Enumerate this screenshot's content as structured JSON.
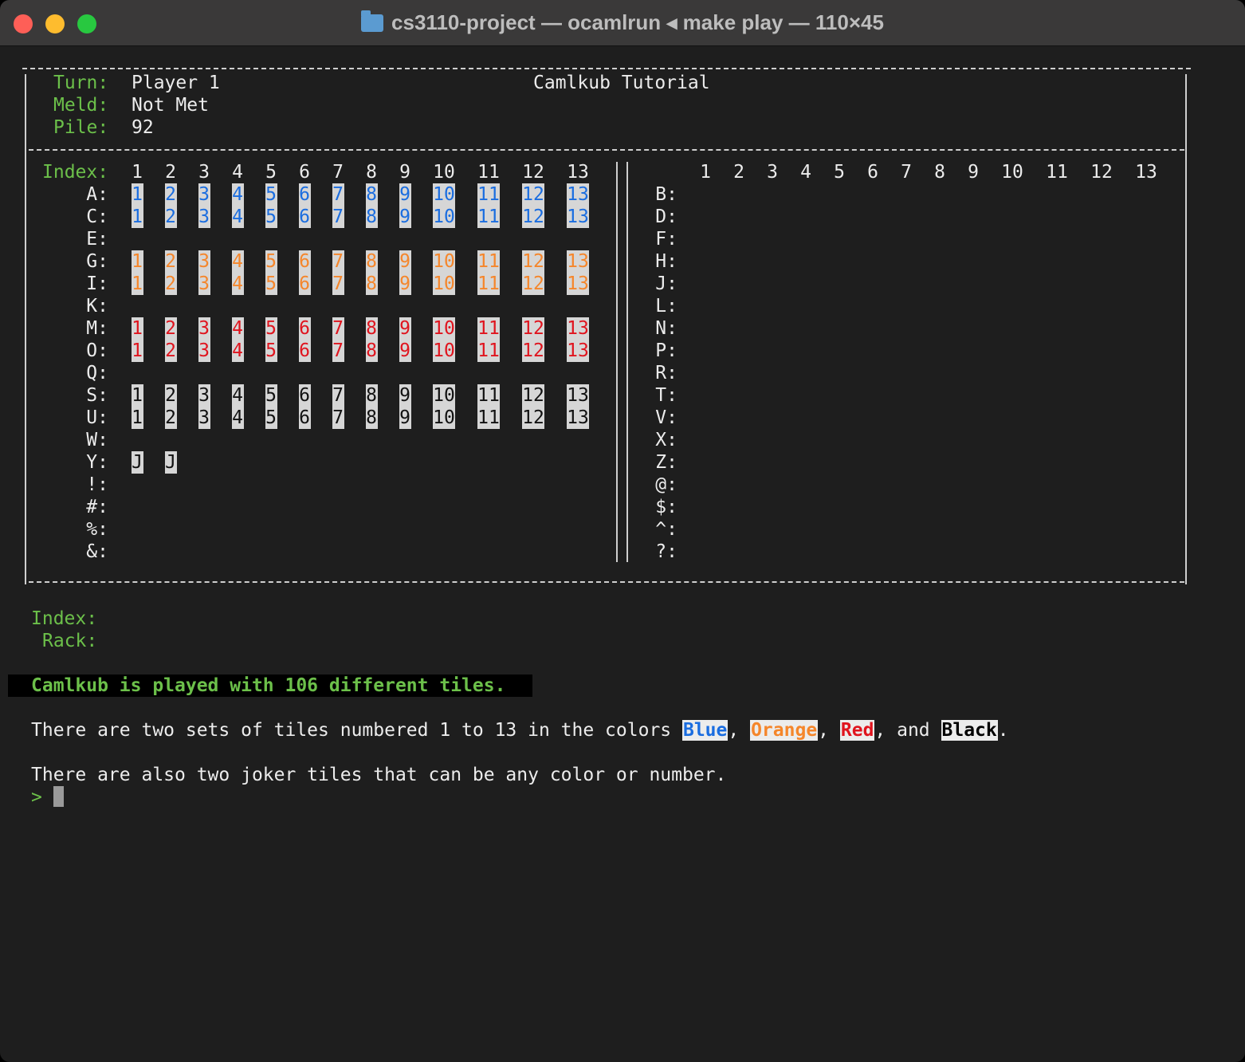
{
  "window": {
    "title": "cs3110-project — ocamlrun ◂ make play — 110×45",
    "folder_icon": "folder-icon"
  },
  "header": {
    "turn_label": "Turn:",
    "turn_value": "Player 1",
    "meld_label": "Meld:",
    "meld_value": "Not Met",
    "pile_label": "Pile:",
    "pile_value": "92",
    "title": "Camlkub Tutorial"
  },
  "board": {
    "index_label": "Index:",
    "columns": [
      "1",
      "2",
      "3",
      "4",
      "5",
      "6",
      "7",
      "8",
      "9",
      "10",
      "11",
      "12",
      "13"
    ],
    "left_rows": [
      "A:",
      "C:",
      "E:",
      "G:",
      "I:",
      "K:",
      "M:",
      "O:",
      "Q:",
      "S:",
      "U:",
      "W:",
      "Y:",
      "!:",
      "#:",
      "%:",
      "&:"
    ],
    "right_rows": [
      "B:",
      "D:",
      "F:",
      "H:",
      "J:",
      "L:",
      "N:",
      "P:",
      "R:",
      "T:",
      "V:",
      "X:",
      "Z:",
      "@:",
      "$:",
      "^:",
      "?:"
    ],
    "left_tiles": [
      {
        "row": 0,
        "color": "#1a6de0",
        "values": [
          "1",
          "2",
          "3",
          "4",
          "5",
          "6",
          "7",
          "8",
          "9",
          "10",
          "11",
          "12",
          "13"
        ]
      },
      {
        "row": 1,
        "color": "#1a6de0",
        "values": [
          "1",
          "2",
          "3",
          "4",
          "5",
          "6",
          "7",
          "8",
          "9",
          "10",
          "11",
          "12",
          "13"
        ]
      },
      {
        "row": 3,
        "color": "#f5862b",
        "values": [
          "1",
          "2",
          "3",
          "4",
          "5",
          "6",
          "7",
          "8",
          "9",
          "10",
          "11",
          "12",
          "13"
        ]
      },
      {
        "row": 4,
        "color": "#f5862b",
        "values": [
          "1",
          "2",
          "3",
          "4",
          "5",
          "6",
          "7",
          "8",
          "9",
          "10",
          "11",
          "12",
          "13"
        ]
      },
      {
        "row": 6,
        "color": "#e0141e",
        "values": [
          "1",
          "2",
          "3",
          "4",
          "5",
          "6",
          "7",
          "8",
          "9",
          "10",
          "11",
          "12",
          "13"
        ]
      },
      {
        "row": 7,
        "color": "#e0141e",
        "values": [
          "1",
          "2",
          "3",
          "4",
          "5",
          "6",
          "7",
          "8",
          "9",
          "10",
          "11",
          "12",
          "13"
        ]
      },
      {
        "row": 9,
        "color": "#111111",
        "values": [
          "1",
          "2",
          "3",
          "4",
          "5",
          "6",
          "7",
          "8",
          "9",
          "10",
          "11",
          "12",
          "13"
        ]
      },
      {
        "row": 10,
        "color": "#111111",
        "values": [
          "1",
          "2",
          "3",
          "4",
          "5",
          "6",
          "7",
          "8",
          "9",
          "10",
          "11",
          "12",
          "13"
        ]
      },
      {
        "row": 12,
        "color": "#111111",
        "values": [
          "J",
          "J"
        ]
      }
    ]
  },
  "rack": {
    "index_label": "Index:",
    "rack_label": "Rack:"
  },
  "tutorial": {
    "headline": "Camlkub is played with 106 different tiles.",
    "line1_before": "There are two sets of tiles numbered 1 to 13 in the colors ",
    "color_blue": "Blue",
    "sep1": ", ",
    "color_orange": "Orange",
    "sep2": ", ",
    "color_red": "Red",
    "sep3": ", and ",
    "color_black": "Black",
    "line1_end": ".",
    "line2": "There are also two joker tiles that can be any color or number."
  },
  "prompt": {
    "symbol": ">"
  },
  "colors": {
    "blue": "#1a6de0",
    "orange": "#f5862b",
    "red": "#e0141e",
    "black": "#111111",
    "label_green": "#6cc04a"
  }
}
